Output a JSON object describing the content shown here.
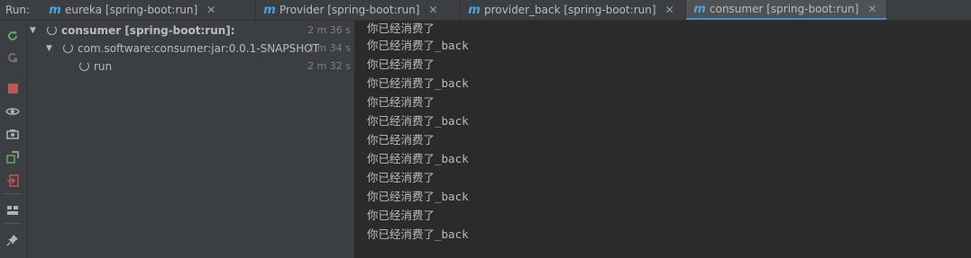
{
  "run_label": "Run:",
  "tabs": [
    {
      "label": "eureka [spring-boot:run]",
      "active": false
    },
    {
      "label": "Provider [spring-boot:run]",
      "active": false
    },
    {
      "label": "provider_back [spring-boot:run]",
      "active": false
    },
    {
      "label": "consumer [spring-boot:run]",
      "active": true
    }
  ],
  "toolbar": [
    "rerun-icon",
    "rerun-failed-icon",
    "stop-icon",
    "view-icon",
    "screenshot-icon",
    "restore-layout-icon",
    "exit-icon",
    "layout-icon",
    "pin-icon"
  ],
  "tree": [
    {
      "label": "consumer [spring-boot:run]:",
      "time": "2 m 36 s"
    },
    {
      "label": "com.software:consumer:jar:0.0.1-SNAPSHOT",
      "time": "2 m 34 s"
    },
    {
      "label": "run",
      "time": "2 m 32 s"
    }
  ],
  "console": [
    "你已经消费了",
    "你已经消费了_back",
    "你已经消费了",
    "你已经消费了_back",
    "你已经消费了",
    "你已经消费了_back",
    "你已经消费了",
    "你已经消费了_back",
    "你已经消费了",
    "你已经消费了_back",
    "你已经消费了",
    "你已经消费了_back"
  ]
}
